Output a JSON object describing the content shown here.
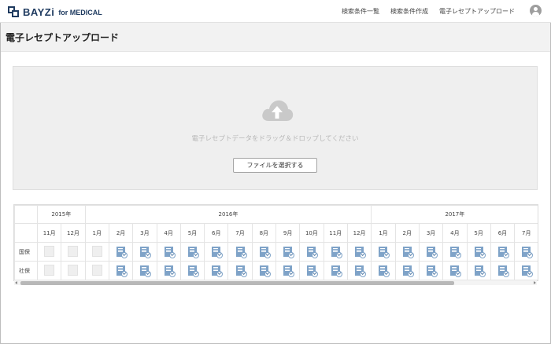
{
  "header": {
    "logo_text": "BAYZi",
    "logo_sub": "for MEDICAL",
    "nav": [
      "検索条件一覧",
      "検索条件作成",
      "電子レセプトアップロード"
    ],
    "avatar_icon": "user-avatar-icon"
  },
  "page": {
    "title": "電子レセプトアップロード"
  },
  "upload": {
    "icon": "cloud-upload-icon",
    "instruction": "電子レセプトデータをドラッグ＆ドロップしてください",
    "select_button": "ファイルを選択する"
  },
  "table": {
    "years": [
      {
        "label": "2015年",
        "span": 2
      },
      {
        "label": "2016年",
        "span": 12
      },
      {
        "label": "2017年",
        "span": 7
      }
    ],
    "months": [
      "11月",
      "12月",
      "1月",
      "2月",
      "3月",
      "4月",
      "5月",
      "6月",
      "7月",
      "8月",
      "9月",
      "10月",
      "11月",
      "12月",
      "1月",
      "2月",
      "3月",
      "4月",
      "5月",
      "6月",
      "7月"
    ],
    "rows": [
      {
        "label": "国保",
        "status": [
          0,
          0,
          0,
          1,
          1,
          1,
          1,
          1,
          1,
          1,
          1,
          1,
          1,
          1,
          1,
          1,
          1,
          1,
          1,
          1,
          1
        ]
      },
      {
        "label": "社保",
        "status": [
          0,
          0,
          0,
          1,
          1,
          1,
          1,
          1,
          1,
          1,
          1,
          1,
          1,
          1,
          1,
          1,
          1,
          1,
          1,
          1,
          1
        ]
      }
    ]
  },
  "scroll": {
    "position_fraction": 0.0,
    "visible_fraction": 0.85
  }
}
